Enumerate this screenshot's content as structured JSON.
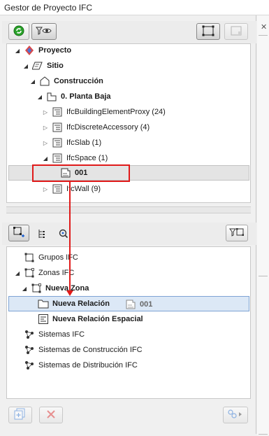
{
  "window": {
    "title": "Gestor de Proyecto IFC"
  },
  "top_toolbar": {
    "refresh_icon": "refresh-icon",
    "filter_eye_icon": "filter-eye-icon",
    "hierarchy_icon": "hierarchy-icon",
    "hierarchy_disabled_icon": "hierarchy-alt-icon"
  },
  "project_tree": {
    "items": [
      {
        "label": "Proyecto",
        "icon": "project-icon",
        "expanded": true
      },
      {
        "label": "Sitio",
        "icon": "site-icon",
        "expanded": true
      },
      {
        "label": "Construcción",
        "icon": "building-icon",
        "expanded": true
      },
      {
        "label": "0. Planta Baja",
        "icon": "storey-icon",
        "expanded": true
      },
      {
        "label": "IfcBuildingElementProxy (24)",
        "icon": "ifc-type-icon",
        "expanded": false
      },
      {
        "label": "IfcDiscreteAccessory (4)",
        "icon": "ifc-type-icon",
        "expanded": false
      },
      {
        "label": "IfcSlab (1)",
        "icon": "ifc-type-icon",
        "expanded": false
      },
      {
        "label": "IfcSpace (1)",
        "icon": "ifc-type-icon",
        "expanded": true
      },
      {
        "label": "001",
        "icon": "space-icon",
        "selected": true
      },
      {
        "label": "IfcWall (9)",
        "icon": "ifc-type-icon",
        "expanded": false
      }
    ]
  },
  "mid_toolbar": {
    "groups_view_icon": "group-tree-icon",
    "list_view_icon": "list-tree-icon",
    "search_icon": "search-icon",
    "filter_icon": "filter-hierarchy-icon"
  },
  "groups_tree": {
    "items": [
      {
        "label": "Grupos IFC",
        "icon": "group-icon"
      },
      {
        "label": "Zonas IFC",
        "icon": "zone-icon",
        "expanded": true
      },
      {
        "label": "Nueva Zona",
        "icon": "zone-icon",
        "expanded": true
      },
      {
        "label": "Nueva Relación",
        "icon": "folder-icon",
        "selected": true
      },
      {
        "label": "Nueva Relación Espacial",
        "icon": "spatial-relation-icon"
      },
      {
        "label": "Sistemas IFC",
        "icon": "system-icon"
      },
      {
        "label": "Sistemas de Construcción IFC",
        "icon": "system-icon"
      },
      {
        "label": "Sistemas de Distribución IFC",
        "icon": "system-icon"
      }
    ],
    "drag_ghost": {
      "label": "001",
      "icon": "space-icon"
    }
  },
  "bottom_toolbar": {
    "add_icon": "add-icon",
    "delete_icon": "delete-icon",
    "assign_icon": "assign-icon"
  },
  "colors": {
    "annotation_red": "#e01a1a",
    "selection_blue": "#dce8f6",
    "selection_gray": "#e4e4e4"
  }
}
